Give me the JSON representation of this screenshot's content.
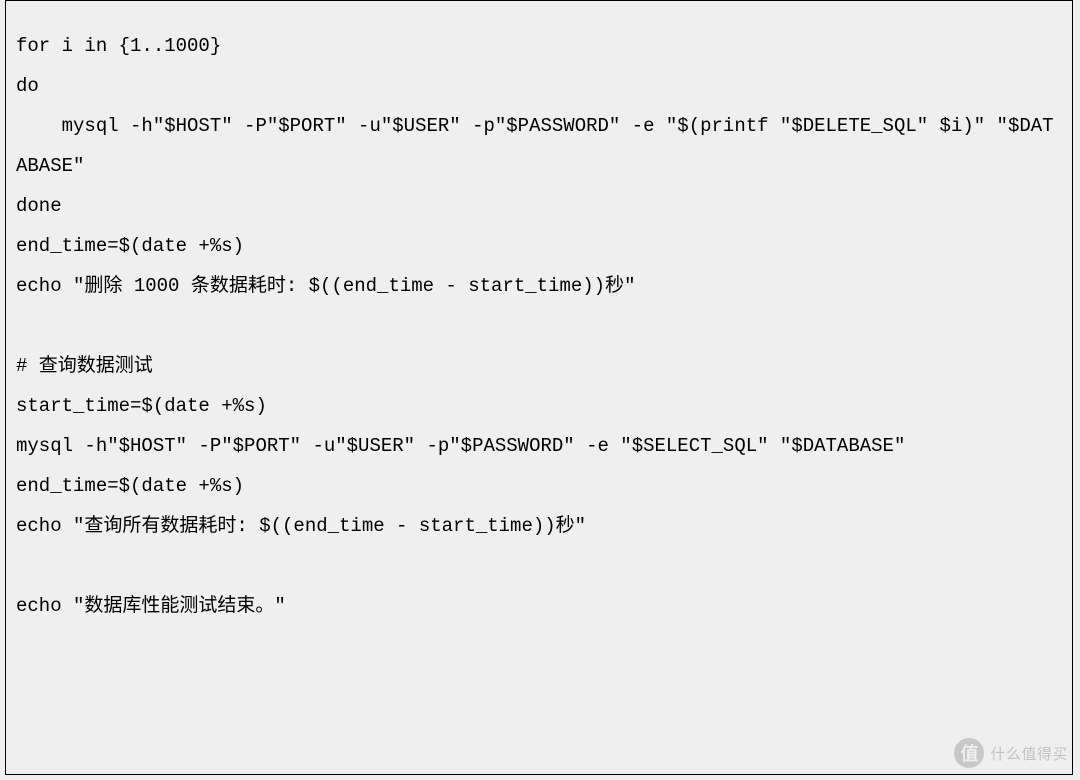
{
  "code": {
    "lines": [
      "for i in {1..1000}",
      "do",
      "    mysql -h\"$HOST\" -P\"$PORT\" -u\"$USER\" -p\"$PASSWORD\" -e \"$(printf \"$DELETE_SQL\" $i)\" \"$DATABASE\"",
      "done",
      "end_time=$(date +%s)",
      "echo \"删除 1000 条数据耗时: $((end_time - start_time))秒\"",
      "",
      "# 查询数据测试",
      "start_time=$(date +%s)",
      "mysql -h\"$HOST\" -P\"$PORT\" -u\"$USER\" -p\"$PASSWORD\" -e \"$SELECT_SQL\" \"$DATABASE\"",
      "end_time=$(date +%s)",
      "echo \"查询所有数据耗时: $((end_time - start_time))秒\"",
      "",
      "echo \"数据库性能测试结束。\""
    ]
  },
  "watermark": {
    "badge": "值",
    "text": "什么值得买"
  }
}
